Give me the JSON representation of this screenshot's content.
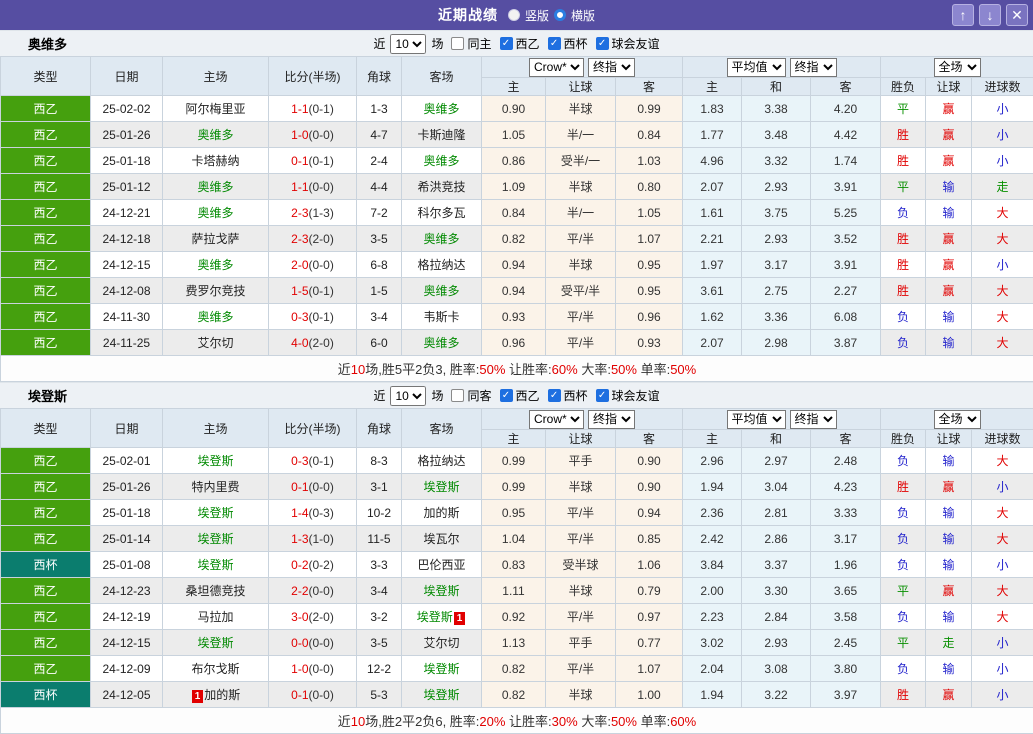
{
  "title_bar": {
    "title": "近期战绩",
    "vertical_label": "竖版",
    "horizontal_label": "横版",
    "icons": {
      "up": "↑",
      "down": "↓",
      "close": "✕"
    }
  },
  "colors": {
    "titlebar_purple": "#564ea2",
    "league_green": "#45a00e",
    "league_teal": "#0b7d6e",
    "win_red": "#e10000",
    "draw_green": "#089000",
    "lose_blue": "#2222cc",
    "crow_col_bg": "#fbf3e9",
    "avg_col_bg": "#e9f4f9"
  },
  "table_cols": {
    "type": "类型",
    "date": "日期",
    "home": "主场",
    "score": "比分(半场)",
    "corner": "角球",
    "away": "客场",
    "crow": "Crow*",
    "final1": "终指",
    "avg": "平均值",
    "final2": "终指",
    "full": "全场",
    "home_odds": "主",
    "handicap": "让球",
    "away_odds": "客",
    "avg_home": "主",
    "avg_draw": "和",
    "avg_away": "客",
    "result": "胜负",
    "asian": "让球",
    "goals": "进球数"
  },
  "sections": [
    {
      "team": "奥维多",
      "filter": {
        "near": "近",
        "count": "10",
        "games": "场",
        "same_label": "同主",
        "same_checked": false,
        "leagues": [
          "西乙",
          "西杯",
          "球会友谊"
        ]
      },
      "rows": [
        {
          "lg": "西乙",
          "lgc": "green",
          "date": "25-02-02",
          "h": "阿尔梅里亚",
          "hf": false,
          "hb": null,
          "s": "1-1",
          "hs": "(0-1)",
          "c": "1-3",
          "a": "奥维多",
          "af": true,
          "ab": null,
          "o1": "0.90",
          "o2": "半球",
          "o3": "0.99",
          "a1": "1.83",
          "a2": "3.38",
          "a3": "4.20",
          "r": [
            "平",
            "g"
          ],
          "l": [
            "赢",
            "r"
          ],
          "g": [
            "小",
            "b"
          ]
        },
        {
          "lg": "西乙",
          "lgc": "green",
          "date": "25-01-26",
          "h": "奥维多",
          "hf": true,
          "hb": null,
          "s": "1-0",
          "hs": "(0-0)",
          "c": "4-7",
          "a": "卡斯迪隆",
          "af": false,
          "ab": null,
          "o1": "1.05",
          "o2": "半/一",
          "o3": "0.84",
          "a1": "1.77",
          "a2": "3.48",
          "a3": "4.42",
          "r": [
            "胜",
            "r"
          ],
          "l": [
            "赢",
            "r"
          ],
          "g": [
            "小",
            "b"
          ]
        },
        {
          "lg": "西乙",
          "lgc": "green",
          "date": "25-01-18",
          "h": "卡塔赫纳",
          "hf": false,
          "hb": null,
          "s": "0-1",
          "hs": "(0-1)",
          "c": "2-4",
          "a": "奥维多",
          "af": true,
          "ab": null,
          "o1": "0.86",
          "o2": "受半/一",
          "o3": "1.03",
          "a1": "4.96",
          "a2": "3.32",
          "a3": "1.74",
          "r": [
            "胜",
            "r"
          ],
          "l": [
            "赢",
            "r"
          ],
          "g": [
            "小",
            "b"
          ]
        },
        {
          "lg": "西乙",
          "lgc": "green",
          "date": "25-01-12",
          "h": "奥维多",
          "hf": true,
          "hb": null,
          "s": "1-1",
          "hs": "(0-0)",
          "c": "4-4",
          "a": "希洪竞技",
          "af": false,
          "ab": null,
          "o1": "1.09",
          "o2": "半球",
          "o3": "0.80",
          "a1": "2.07",
          "a2": "2.93",
          "a3": "3.91",
          "r": [
            "平",
            "g"
          ],
          "l": [
            "输",
            "b"
          ],
          "g": [
            "走",
            "g"
          ]
        },
        {
          "lg": "西乙",
          "lgc": "green",
          "date": "24-12-21",
          "h": "奥维多",
          "hf": true,
          "hb": null,
          "s": "2-3",
          "hs": "(1-3)",
          "c": "7-2",
          "a": "科尔多瓦",
          "af": false,
          "ab": null,
          "o1": "0.84",
          "o2": "半/一",
          "o3": "1.05",
          "a1": "1.61",
          "a2": "3.75",
          "a3": "5.25",
          "r": [
            "负",
            "b"
          ],
          "l": [
            "输",
            "b"
          ],
          "g": [
            "大",
            "r"
          ]
        },
        {
          "lg": "西乙",
          "lgc": "green",
          "date": "24-12-18",
          "h": "萨拉戈萨",
          "hf": false,
          "hb": null,
          "s": "2-3",
          "hs": "(2-0)",
          "c": "3-5",
          "a": "奥维多",
          "af": true,
          "ab": null,
          "o1": "0.82",
          "o2": "平/半",
          "o3": "1.07",
          "a1": "2.21",
          "a2": "2.93",
          "a3": "3.52",
          "r": [
            "胜",
            "r"
          ],
          "l": [
            "赢",
            "r"
          ],
          "g": [
            "大",
            "r"
          ]
        },
        {
          "lg": "西乙",
          "lgc": "green",
          "date": "24-12-15",
          "h": "奥维多",
          "hf": true,
          "hb": null,
          "s": "2-0",
          "hs": "(0-0)",
          "c": "6-8",
          "a": "格拉纳达",
          "af": false,
          "ab": null,
          "o1": "0.94",
          "o2": "半球",
          "o3": "0.95",
          "a1": "1.97",
          "a2": "3.17",
          "a3": "3.91",
          "r": [
            "胜",
            "r"
          ],
          "l": [
            "赢",
            "r"
          ],
          "g": [
            "小",
            "b"
          ]
        },
        {
          "lg": "西乙",
          "lgc": "green",
          "date": "24-12-08",
          "h": "费罗尔竞技",
          "hf": false,
          "hb": null,
          "s": "1-5",
          "hs": "(0-1)",
          "c": "1-5",
          "a": "奥维多",
          "af": true,
          "ab": null,
          "o1": "0.94",
          "o2": "受平/半",
          "o3": "0.95",
          "a1": "3.61",
          "a2": "2.75",
          "a3": "2.27",
          "r": [
            "胜",
            "r"
          ],
          "l": [
            "赢",
            "r"
          ],
          "g": [
            "大",
            "r"
          ]
        },
        {
          "lg": "西乙",
          "lgc": "green",
          "date": "24-11-30",
          "h": "奥维多",
          "hf": true,
          "hb": null,
          "s": "0-3",
          "hs": "(0-1)",
          "c": "3-4",
          "a": "韦斯卡",
          "af": false,
          "ab": null,
          "o1": "0.93",
          "o2": "平/半",
          "o3": "0.96",
          "a1": "1.62",
          "a2": "3.36",
          "a3": "6.08",
          "r": [
            "负",
            "b"
          ],
          "l": [
            "输",
            "b"
          ],
          "g": [
            "大",
            "r"
          ]
        },
        {
          "lg": "西乙",
          "lgc": "green",
          "date": "24-11-25",
          "h": "艾尔切",
          "hf": false,
          "hb": null,
          "s": "4-0",
          "hs": "(2-0)",
          "c": "6-0",
          "a": "奥维多",
          "af": true,
          "ab": null,
          "o1": "0.96",
          "o2": "平/半",
          "o3": "0.93",
          "a1": "2.07",
          "a2": "2.98",
          "a3": "3.87",
          "r": [
            "负",
            "b"
          ],
          "l": [
            "输",
            "b"
          ],
          "g": [
            "大",
            "r"
          ]
        }
      ],
      "summary": [
        [
          "近",
          0
        ],
        [
          "10",
          1
        ],
        [
          "场,胜5平2负3, 胜率:",
          0
        ],
        [
          "50%",
          1
        ],
        [
          " 让胜率:",
          0
        ],
        [
          "60%",
          1
        ],
        [
          " 大率:",
          0
        ],
        [
          "50%",
          1
        ],
        [
          " 单率:",
          0
        ],
        [
          "50%",
          1
        ]
      ]
    },
    {
      "team": "埃登斯",
      "filter": {
        "near": "近",
        "count": "10",
        "games": "场",
        "same_label": "同客",
        "same_checked": false,
        "leagues": [
          "西乙",
          "西杯",
          "球会友谊"
        ]
      },
      "rows": [
        {
          "lg": "西乙",
          "lgc": "green",
          "date": "25-02-01",
          "h": "埃登斯",
          "hf": true,
          "hb": null,
          "s": "0-3",
          "hs": "(0-1)",
          "c": "8-3",
          "a": "格拉纳达",
          "af": false,
          "ab": null,
          "o1": "0.99",
          "o2": "平手",
          "o3": "0.90",
          "a1": "2.96",
          "a2": "2.97",
          "a3": "2.48",
          "r": [
            "负",
            "b"
          ],
          "l": [
            "输",
            "b"
          ],
          "g": [
            "大",
            "r"
          ]
        },
        {
          "lg": "西乙",
          "lgc": "green",
          "date": "25-01-26",
          "h": "特内里费",
          "hf": false,
          "hb": null,
          "s": "0-1",
          "hs": "(0-0)",
          "c": "3-1",
          "a": "埃登斯",
          "af": true,
          "ab": null,
          "o1": "0.99",
          "o2": "半球",
          "o3": "0.90",
          "a1": "1.94",
          "a2": "3.04",
          "a3": "4.23",
          "r": [
            "胜",
            "r"
          ],
          "l": [
            "赢",
            "r"
          ],
          "g": [
            "小",
            "b"
          ]
        },
        {
          "lg": "西乙",
          "lgc": "green",
          "date": "25-01-18",
          "h": "埃登斯",
          "hf": true,
          "hb": null,
          "s": "1-4",
          "hs": "(0-3)",
          "c": "10-2",
          "a": "加的斯",
          "af": false,
          "ab": null,
          "o1": "0.95",
          "o2": "平/半",
          "o3": "0.94",
          "a1": "2.36",
          "a2": "2.81",
          "a3": "3.33",
          "r": [
            "负",
            "b"
          ],
          "l": [
            "输",
            "b"
          ],
          "g": [
            "大",
            "r"
          ]
        },
        {
          "lg": "西乙",
          "lgc": "green",
          "date": "25-01-14",
          "h": "埃登斯",
          "hf": true,
          "hb": null,
          "s": "1-3",
          "hs": "(1-0)",
          "c": "11-5",
          "a": "埃瓦尔",
          "af": false,
          "ab": null,
          "o1": "1.04",
          "o2": "平/半",
          "o3": "0.85",
          "a1": "2.42",
          "a2": "2.86",
          "a3": "3.17",
          "r": [
            "负",
            "b"
          ],
          "l": [
            "输",
            "b"
          ],
          "g": [
            "大",
            "r"
          ]
        },
        {
          "lg": "西杯",
          "lgc": "teal",
          "date": "25-01-08",
          "h": "埃登斯",
          "hf": true,
          "hb": null,
          "s": "0-2",
          "hs": "(0-2)",
          "c": "3-3",
          "a": "巴伦西亚",
          "af": false,
          "ab": null,
          "o1": "0.83",
          "o2": "受半球",
          "o3": "1.06",
          "a1": "3.84",
          "a2": "3.37",
          "a3": "1.96",
          "r": [
            "负",
            "b"
          ],
          "l": [
            "输",
            "b"
          ],
          "g": [
            "小",
            "b"
          ]
        },
        {
          "lg": "西乙",
          "lgc": "green",
          "date": "24-12-23",
          "h": "桑坦德竞技",
          "hf": false,
          "hb": null,
          "s": "2-2",
          "hs": "(0-0)",
          "c": "3-4",
          "a": "埃登斯",
          "af": true,
          "ab": null,
          "o1": "1.11",
          "o2": "半球",
          "o3": "0.79",
          "a1": "2.00",
          "a2": "3.30",
          "a3": "3.65",
          "r": [
            "平",
            "g"
          ],
          "l": [
            "赢",
            "r"
          ],
          "g": [
            "大",
            "r"
          ]
        },
        {
          "lg": "西乙",
          "lgc": "green",
          "date": "24-12-19",
          "h": "马拉加",
          "hf": false,
          "hb": null,
          "s": "3-0",
          "hs": "(2-0)",
          "c": "3-2",
          "a": "埃登斯",
          "af": true,
          "ab": "1",
          "o1": "0.92",
          "o2": "平/半",
          "o3": "0.97",
          "a1": "2.23",
          "a2": "2.84",
          "a3": "3.58",
          "r": [
            "负",
            "b"
          ],
          "l": [
            "输",
            "b"
          ],
          "g": [
            "大",
            "r"
          ]
        },
        {
          "lg": "西乙",
          "lgc": "green",
          "date": "24-12-15",
          "h": "埃登斯",
          "hf": true,
          "hb": null,
          "s": "0-0",
          "hs": "(0-0)",
          "c": "3-5",
          "a": "艾尔切",
          "af": false,
          "ab": null,
          "o1": "1.13",
          "o2": "平手",
          "o3": "0.77",
          "a1": "3.02",
          "a2": "2.93",
          "a3": "2.45",
          "r": [
            "平",
            "g"
          ],
          "l": [
            "走",
            "g"
          ],
          "g": [
            "小",
            "b"
          ]
        },
        {
          "lg": "西乙",
          "lgc": "green",
          "date": "24-12-09",
          "h": "布尔戈斯",
          "hf": false,
          "hb": null,
          "s": "1-0",
          "hs": "(0-0)",
          "c": "12-2",
          "a": "埃登斯",
          "af": true,
          "ab": null,
          "o1": "0.82",
          "o2": "平/半",
          "o3": "1.07",
          "a1": "2.04",
          "a2": "3.08",
          "a3": "3.80",
          "r": [
            "负",
            "b"
          ],
          "l": [
            "输",
            "b"
          ],
          "g": [
            "小",
            "b"
          ]
        },
        {
          "lg": "西杯",
          "lgc": "teal",
          "date": "24-12-05",
          "h": "加的斯",
          "hf": false,
          "hb": "1",
          "s": "0-1",
          "hs": "(0-0)",
          "c": "5-3",
          "a": "埃登斯",
          "af": true,
          "ab": null,
          "o1": "0.82",
          "o2": "半球",
          "o3": "1.00",
          "a1": "1.94",
          "a2": "3.22",
          "a3": "3.97",
          "r": [
            "胜",
            "r"
          ],
          "l": [
            "赢",
            "r"
          ],
          "g": [
            "小",
            "b"
          ]
        }
      ],
      "summary": [
        [
          "近",
          0
        ],
        [
          "10",
          1
        ],
        [
          "场,胜2平2负6, 胜率:",
          0
        ],
        [
          "20%",
          1
        ],
        [
          " 让胜率:",
          0
        ],
        [
          "30%",
          1
        ],
        [
          " 大率:",
          0
        ],
        [
          "50%",
          1
        ],
        [
          " 单率:",
          0
        ],
        [
          "60%",
          1
        ]
      ]
    }
  ]
}
